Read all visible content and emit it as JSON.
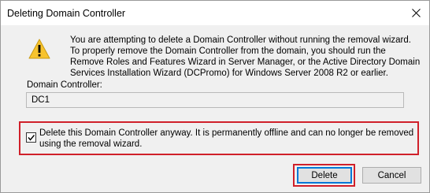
{
  "window": {
    "title": "Deleting Domain Controller",
    "close_icon": "close-icon"
  },
  "warning": {
    "icon": "warning-icon",
    "message": "You are attempting to delete a Domain Controller without running the removal wizard. To properly remove the Domain Controller from the domain, you should run the Remove Roles and Features Wizard in Server Manager, or the Active Directory Domain Services Installation Wizard (DCPromo) for Windows Server 2008 R2 or earlier."
  },
  "domain_controller": {
    "label": "Domain Controller:",
    "value": "DC1"
  },
  "confirm": {
    "checked": true,
    "label": "Delete this Domain Controller anyway. It is permanently offline and can no longer be removed using the removal wizard."
  },
  "buttons": {
    "delete": "Delete",
    "cancel": "Cancel"
  },
  "colors": {
    "highlight": "#d0202a",
    "focus": "#0078d7",
    "warning_fill": "#f7c32e"
  }
}
